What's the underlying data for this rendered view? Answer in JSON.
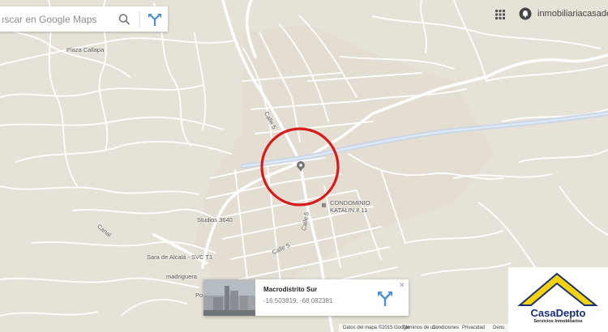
{
  "search": {
    "placeholder": "ıscar en Google Maps"
  },
  "top_bar": {
    "account_name": "inmobiliariacasadepto"
  },
  "map_labels": {
    "plaza_callapa": "Plaza Callapa",
    "calle_5_north": "Calle 5",
    "calle_5_mid": "Calle 5",
    "calle_5_south": "Calle 5",
    "condominio_line1": "CONDOMINIO",
    "condominio_line2": "KATALIN # 11",
    "studios": "Studios 3640",
    "canal": "Canal",
    "sara": "Sara de Alcalá - SVC T1",
    "madriguera": "madriguera",
    "po": "Po"
  },
  "place_card": {
    "title": "Macrodistrito Sur",
    "coordinates": "-16.503819, -68.082381"
  },
  "footer": {
    "map_data": "Datos del mapa ©2015 Google",
    "terms": "Términos de uso",
    "conditions": "Condiciones",
    "privacy": "Privacidad",
    "report": "Denu"
  },
  "logo": {
    "name": "CasaDepto",
    "tagline": "Servicios Inmobiliarios"
  },
  "colors": {
    "land": "#e7e2d7",
    "road": "#ffffff",
    "avenue": "#cfdaea",
    "highlight_circle": "#d91a1a",
    "logo_yellow": "#f5d20f",
    "logo_blue": "#1a2f7a",
    "icon_blue": "#4a8fd8"
  }
}
